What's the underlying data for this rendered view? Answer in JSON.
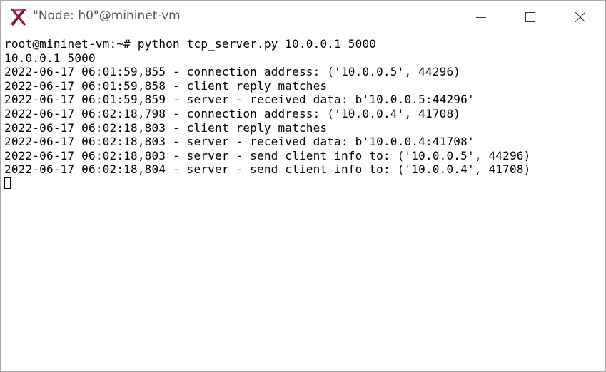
{
  "window": {
    "title": "\"Node: h0\"@mininet-vm",
    "app_icon": "x11-icon",
    "controls": {
      "minimize": "minimize-icon",
      "maximize": "maximize-icon",
      "close": "close-icon"
    }
  },
  "terminal": {
    "lines": [
      "root@mininet-vm:~# python tcp_server.py 10.0.0.1 5000",
      "10.0.0.1 5000",
      "2022-06-17 06:01:59,855 - connection address: ('10.0.0.5', 44296)",
      "2022-06-17 06:01:59,858 - client reply matches",
      "2022-06-17 06:01:59,859 - server - received data: b'10.0.0.5:44296'",
      "2022-06-17 06:02:18,798 - connection address: ('10.0.0.4', 41708)",
      "2022-06-17 06:02:18,803 - client reply matches",
      "2022-06-17 06:02:18,803 - server - received data: b'10.0.0.4:41708'",
      "2022-06-17 06:02:18,803 - server - send client info to: ('10.0.0.5', 44296)",
      "2022-06-17 06:02:18,804 - server - send client info to: ('10.0.0.4', 41708)"
    ]
  },
  "colors": {
    "background": "#ffffff",
    "text": "#000000",
    "title_text": "#555555",
    "icon_red": "#c8102e",
    "icon_blue": "#1a2a8a"
  }
}
